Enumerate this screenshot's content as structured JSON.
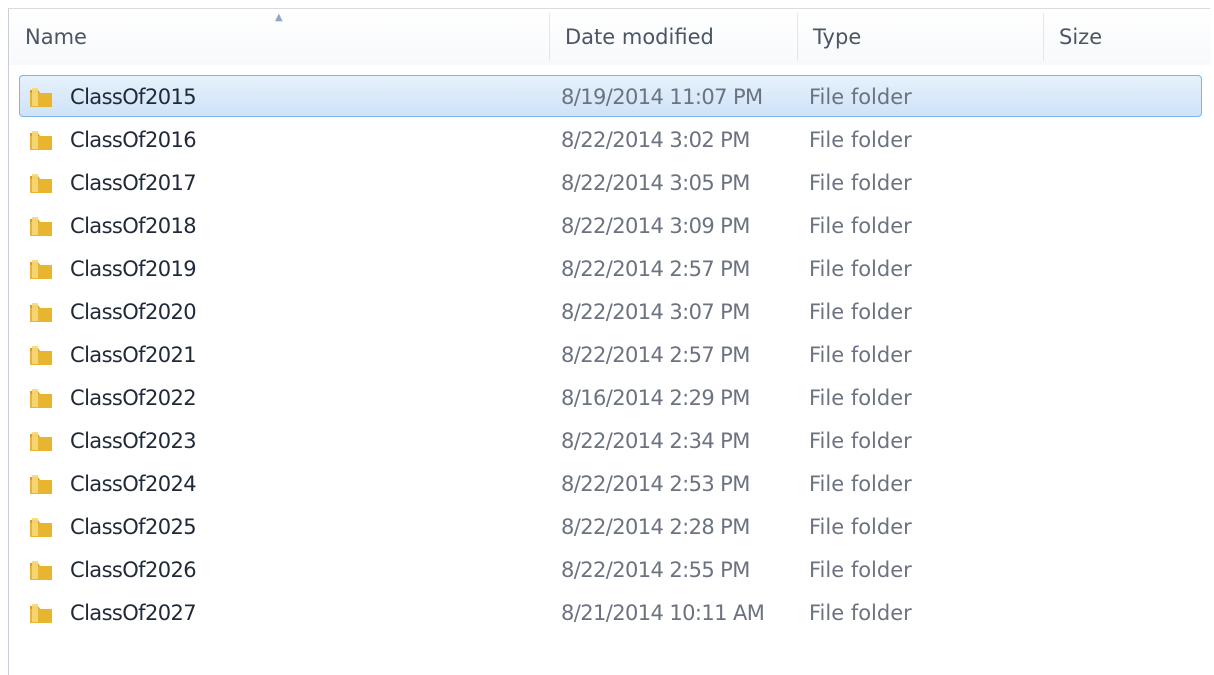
{
  "columns": {
    "name": "Name",
    "date_modified": "Date modified",
    "type": "Type",
    "size": "Size"
  },
  "sort": {
    "column": "name",
    "direction": "ascending"
  },
  "colors": {
    "selection_fill": "#cfe3f8",
    "selection_border": "#7eb4ea",
    "folder": "#e8b530"
  },
  "icons": {
    "folder": "folder-icon"
  },
  "files": [
    {
      "name": "ClassOf2015",
      "date": "8/19/2014 11:07 PM",
      "type": "File folder",
      "size": "",
      "selected": true
    },
    {
      "name": "ClassOf2016",
      "date": "8/22/2014 3:02 PM",
      "type": "File folder",
      "size": "",
      "selected": false
    },
    {
      "name": "ClassOf2017",
      "date": "8/22/2014 3:05 PM",
      "type": "File folder",
      "size": "",
      "selected": false
    },
    {
      "name": "ClassOf2018",
      "date": "8/22/2014 3:09 PM",
      "type": "File folder",
      "size": "",
      "selected": false
    },
    {
      "name": "ClassOf2019",
      "date": "8/22/2014 2:57 PM",
      "type": "File folder",
      "size": "",
      "selected": false
    },
    {
      "name": "ClassOf2020",
      "date": "8/22/2014 3:07 PM",
      "type": "File folder",
      "size": "",
      "selected": false
    },
    {
      "name": "ClassOf2021",
      "date": "8/22/2014 2:57 PM",
      "type": "File folder",
      "size": "",
      "selected": false
    },
    {
      "name": "ClassOf2022",
      "date": "8/16/2014 2:29 PM",
      "type": "File folder",
      "size": "",
      "selected": false
    },
    {
      "name": "ClassOf2023",
      "date": "8/22/2014 2:34 PM",
      "type": "File folder",
      "size": "",
      "selected": false
    },
    {
      "name": "ClassOf2024",
      "date": "8/22/2014 2:53 PM",
      "type": "File folder",
      "size": "",
      "selected": false
    },
    {
      "name": "ClassOf2025",
      "date": "8/22/2014 2:28 PM",
      "type": "File folder",
      "size": "",
      "selected": false
    },
    {
      "name": "ClassOf2026",
      "date": "8/22/2014 2:55 PM",
      "type": "File folder",
      "size": "",
      "selected": false
    },
    {
      "name": "ClassOf2027",
      "date": "8/21/2014 10:11 AM",
      "type": "File folder",
      "size": "",
      "selected": false
    }
  ]
}
